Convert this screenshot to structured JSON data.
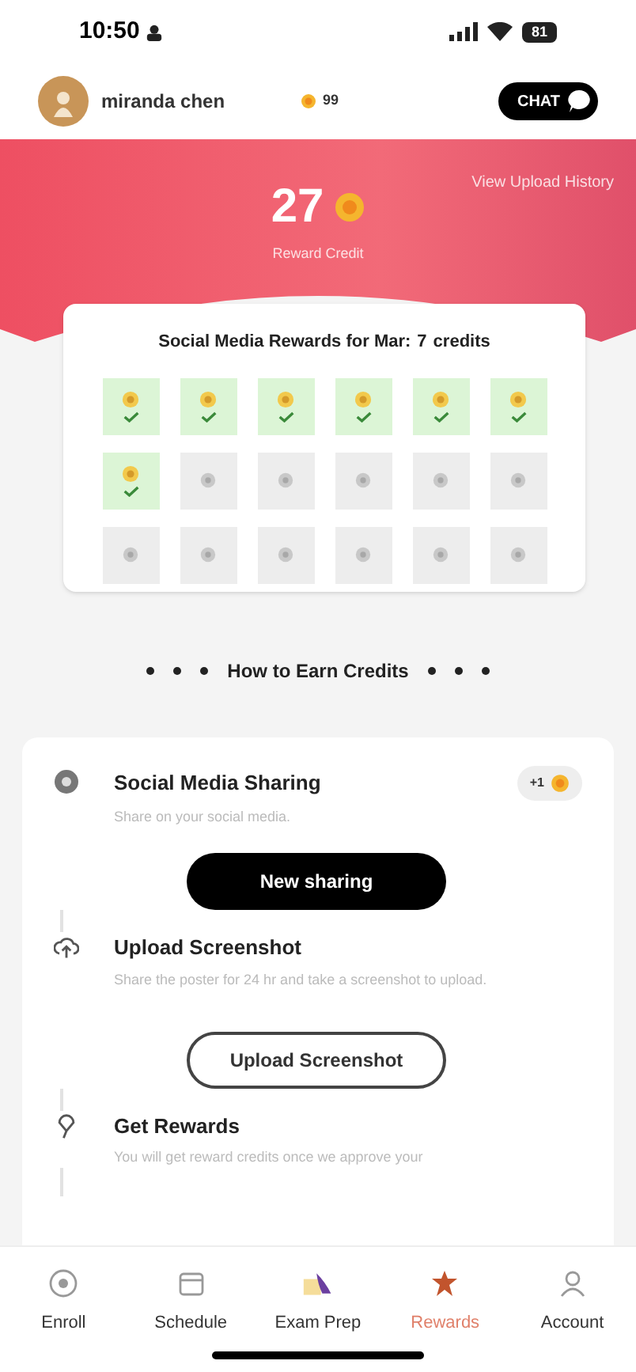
{
  "status_bar": {
    "time": "10:50",
    "battery": "81"
  },
  "header": {
    "user_name": "miranda chen",
    "coins": "99",
    "chat_label": "CHAT"
  },
  "summary": {
    "history_link": "View Upload History",
    "credits": "27",
    "credits_label": "Reward Credit"
  },
  "rewards_card": {
    "title": "Social Media Rewards for Mar:",
    "count": "7",
    "count_unit": "credits",
    "cells": [
      {
        "earned": true
      },
      {
        "earned": true
      },
      {
        "earned": true
      },
      {
        "earned": true
      },
      {
        "earned": true
      },
      {
        "earned": true
      },
      {
        "earned": true
      },
      {
        "earned": false
      },
      {
        "earned": false
      },
      {
        "earned": false
      },
      {
        "earned": false
      },
      {
        "earned": false
      },
      {
        "earned": false
      },
      {
        "earned": false
      },
      {
        "earned": false
      },
      {
        "earned": false
      },
      {
        "earned": false
      },
      {
        "earned": false
      }
    ]
  },
  "earn_heading": "How to Earn Credits",
  "steps": [
    {
      "kind": "share",
      "title": "Social Media Sharing",
      "badge": "+1",
      "description": "Share on your social media.",
      "button": "New sharing"
    },
    {
      "kind": "upload",
      "title": "Upload Screenshot",
      "description": "Share the poster for 24 hr and take a screenshot to upload.",
      "button": "Upload Screenshot"
    },
    {
      "kind": "reward",
      "title": "Get Rewards",
      "description": "You will get reward credits once we approve your"
    }
  ],
  "tabs": [
    {
      "label": "Enroll",
      "selected": false
    },
    {
      "label": "Schedule",
      "selected": false
    },
    {
      "label": "Exam Prep",
      "selected": false
    },
    {
      "label": "Rewards",
      "selected": true
    },
    {
      "label": "Account",
      "selected": false
    }
  ]
}
